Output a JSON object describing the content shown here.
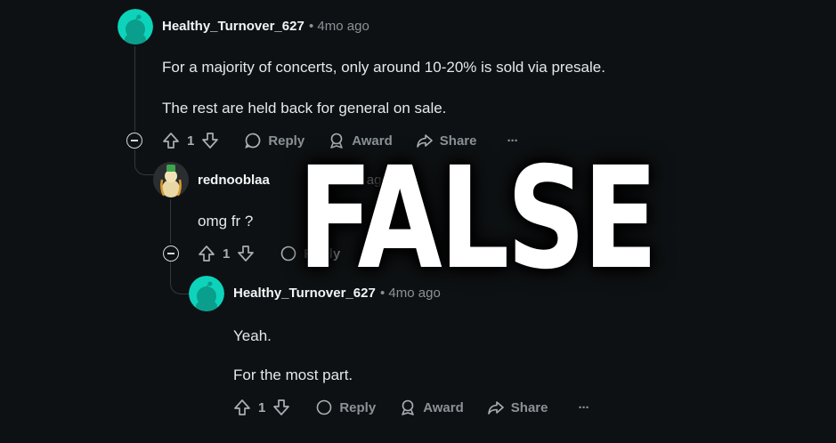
{
  "comments": [
    {
      "username": "Healthy_Turnover_627",
      "meta": "• 4mo ago",
      "paragraphs": [
        "For a majority of concerts, only around 10-20% is sold via presale.",
        "The rest are held back for general on sale."
      ],
      "vote_count": "1",
      "actions": {
        "reply": "Reply",
        "award": "Award",
        "share": "Share",
        "more": "···"
      }
    },
    {
      "username": "rednooblaa",
      "meta": "• 4mo ago",
      "paragraphs": [
        "omg fr ?"
      ],
      "vote_count": "1",
      "actions": {
        "reply": "Reply"
      }
    },
    {
      "username": "Healthy_Turnover_627",
      "meta": "• 4mo ago",
      "paragraphs": [
        "Yeah.",
        "For the most part."
      ],
      "vote_count": "1",
      "actions": {
        "reply": "Reply",
        "award": "Award",
        "share": "Share",
        "more": "···"
      }
    }
  ],
  "overlay": {
    "verdict": "FALSE"
  },
  "colors": {
    "background": "#0e1113",
    "snoo_avatar": "#0dd3bb",
    "overlay_text": "#ffffff"
  },
  "icons": [
    "upvote-icon",
    "downvote-icon",
    "reply-bubble-icon",
    "award-icon",
    "share-icon",
    "more-icon",
    "collapse-icon"
  ]
}
